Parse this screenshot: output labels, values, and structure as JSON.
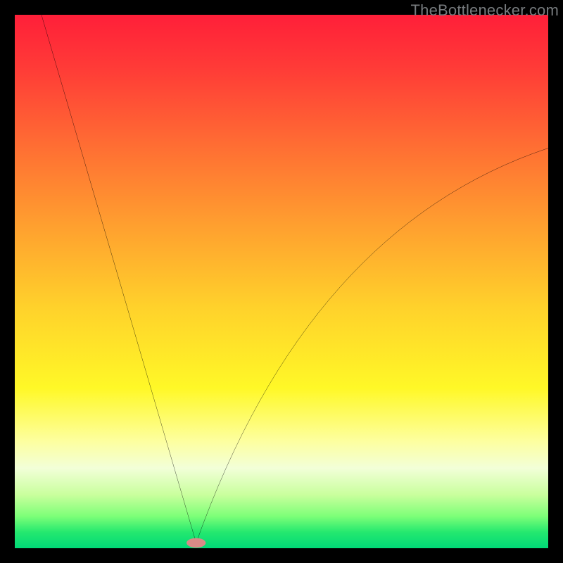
{
  "watermark": "TheBottlenecker.com",
  "chart_data": {
    "type": "line",
    "title": "",
    "xlabel": "",
    "ylabel": "",
    "xlim": [
      0,
      100
    ],
    "ylim": [
      0,
      100
    ],
    "grid": false,
    "curve": {
      "vertex_x": 34,
      "left_start": {
        "x": 5,
        "y": 100
      },
      "right_end": {
        "x": 100,
        "y": 75
      },
      "right_control": {
        "x": 55,
        "y": 60
      }
    },
    "marker": {
      "x": 34,
      "y": 1,
      "color": "#d98b87",
      "rx": 1.8,
      "ry": 0.9
    },
    "gradient_stops": [
      {
        "offset": 0.0,
        "color": "#ff1f39"
      },
      {
        "offset": 0.1,
        "color": "#ff3b37"
      },
      {
        "offset": 0.25,
        "color": "#ff6f33"
      },
      {
        "offset": 0.4,
        "color": "#ffa12f"
      },
      {
        "offset": 0.55,
        "color": "#ffd22b"
      },
      {
        "offset": 0.7,
        "color": "#fff827"
      },
      {
        "offset": 0.8,
        "color": "#fdffa0"
      },
      {
        "offset": 0.85,
        "color": "#f2ffd8"
      },
      {
        "offset": 0.9,
        "color": "#c9ff9d"
      },
      {
        "offset": 0.94,
        "color": "#7dff78"
      },
      {
        "offset": 0.97,
        "color": "#24e86f"
      },
      {
        "offset": 1.0,
        "color": "#00d977"
      }
    ]
  }
}
